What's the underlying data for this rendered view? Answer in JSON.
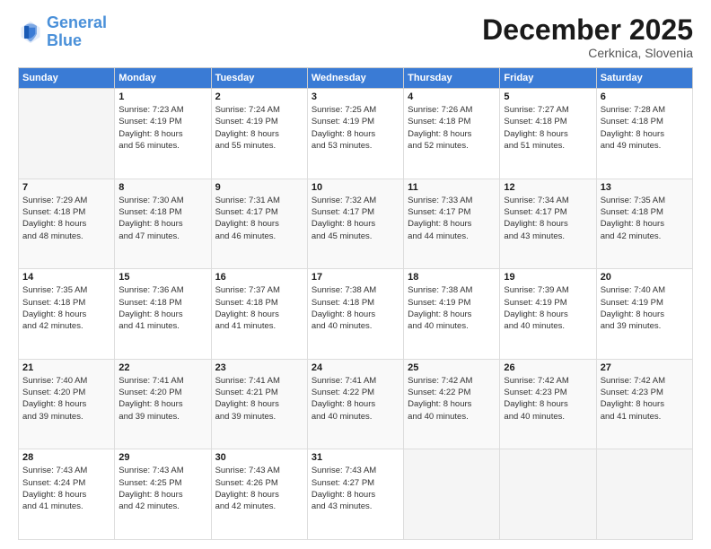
{
  "logo": {
    "line1": "General",
    "line2": "Blue"
  },
  "header": {
    "month": "December 2025",
    "location": "Cerknica, Slovenia"
  },
  "days_of_week": [
    "Sunday",
    "Monday",
    "Tuesday",
    "Wednesday",
    "Thursday",
    "Friday",
    "Saturday"
  ],
  "weeks": [
    [
      {
        "day": "",
        "info": ""
      },
      {
        "day": "1",
        "info": "Sunrise: 7:23 AM\nSunset: 4:19 PM\nDaylight: 8 hours\nand 56 minutes."
      },
      {
        "day": "2",
        "info": "Sunrise: 7:24 AM\nSunset: 4:19 PM\nDaylight: 8 hours\nand 55 minutes."
      },
      {
        "day": "3",
        "info": "Sunrise: 7:25 AM\nSunset: 4:19 PM\nDaylight: 8 hours\nand 53 minutes."
      },
      {
        "day": "4",
        "info": "Sunrise: 7:26 AM\nSunset: 4:18 PM\nDaylight: 8 hours\nand 52 minutes."
      },
      {
        "day": "5",
        "info": "Sunrise: 7:27 AM\nSunset: 4:18 PM\nDaylight: 8 hours\nand 51 minutes."
      },
      {
        "day": "6",
        "info": "Sunrise: 7:28 AM\nSunset: 4:18 PM\nDaylight: 8 hours\nand 49 minutes."
      }
    ],
    [
      {
        "day": "7",
        "info": "Sunrise: 7:29 AM\nSunset: 4:18 PM\nDaylight: 8 hours\nand 48 minutes."
      },
      {
        "day": "8",
        "info": "Sunrise: 7:30 AM\nSunset: 4:18 PM\nDaylight: 8 hours\nand 47 minutes."
      },
      {
        "day": "9",
        "info": "Sunrise: 7:31 AM\nSunset: 4:17 PM\nDaylight: 8 hours\nand 46 minutes."
      },
      {
        "day": "10",
        "info": "Sunrise: 7:32 AM\nSunset: 4:17 PM\nDaylight: 8 hours\nand 45 minutes."
      },
      {
        "day": "11",
        "info": "Sunrise: 7:33 AM\nSunset: 4:17 PM\nDaylight: 8 hours\nand 44 minutes."
      },
      {
        "day": "12",
        "info": "Sunrise: 7:34 AM\nSunset: 4:17 PM\nDaylight: 8 hours\nand 43 minutes."
      },
      {
        "day": "13",
        "info": "Sunrise: 7:35 AM\nSunset: 4:18 PM\nDaylight: 8 hours\nand 42 minutes."
      }
    ],
    [
      {
        "day": "14",
        "info": "Sunrise: 7:35 AM\nSunset: 4:18 PM\nDaylight: 8 hours\nand 42 minutes."
      },
      {
        "day": "15",
        "info": "Sunrise: 7:36 AM\nSunset: 4:18 PM\nDaylight: 8 hours\nand 41 minutes."
      },
      {
        "day": "16",
        "info": "Sunrise: 7:37 AM\nSunset: 4:18 PM\nDaylight: 8 hours\nand 41 minutes."
      },
      {
        "day": "17",
        "info": "Sunrise: 7:38 AM\nSunset: 4:18 PM\nDaylight: 8 hours\nand 40 minutes."
      },
      {
        "day": "18",
        "info": "Sunrise: 7:38 AM\nSunset: 4:19 PM\nDaylight: 8 hours\nand 40 minutes."
      },
      {
        "day": "19",
        "info": "Sunrise: 7:39 AM\nSunset: 4:19 PM\nDaylight: 8 hours\nand 40 minutes."
      },
      {
        "day": "20",
        "info": "Sunrise: 7:40 AM\nSunset: 4:19 PM\nDaylight: 8 hours\nand 39 minutes."
      }
    ],
    [
      {
        "day": "21",
        "info": "Sunrise: 7:40 AM\nSunset: 4:20 PM\nDaylight: 8 hours\nand 39 minutes."
      },
      {
        "day": "22",
        "info": "Sunrise: 7:41 AM\nSunset: 4:20 PM\nDaylight: 8 hours\nand 39 minutes."
      },
      {
        "day": "23",
        "info": "Sunrise: 7:41 AM\nSunset: 4:21 PM\nDaylight: 8 hours\nand 39 minutes."
      },
      {
        "day": "24",
        "info": "Sunrise: 7:41 AM\nSunset: 4:22 PM\nDaylight: 8 hours\nand 40 minutes."
      },
      {
        "day": "25",
        "info": "Sunrise: 7:42 AM\nSunset: 4:22 PM\nDaylight: 8 hours\nand 40 minutes."
      },
      {
        "day": "26",
        "info": "Sunrise: 7:42 AM\nSunset: 4:23 PM\nDaylight: 8 hours\nand 40 minutes."
      },
      {
        "day": "27",
        "info": "Sunrise: 7:42 AM\nSunset: 4:23 PM\nDaylight: 8 hours\nand 41 minutes."
      }
    ],
    [
      {
        "day": "28",
        "info": "Sunrise: 7:43 AM\nSunset: 4:24 PM\nDaylight: 8 hours\nand 41 minutes."
      },
      {
        "day": "29",
        "info": "Sunrise: 7:43 AM\nSunset: 4:25 PM\nDaylight: 8 hours\nand 42 minutes."
      },
      {
        "day": "30",
        "info": "Sunrise: 7:43 AM\nSunset: 4:26 PM\nDaylight: 8 hours\nand 42 minutes."
      },
      {
        "day": "31",
        "info": "Sunrise: 7:43 AM\nSunset: 4:27 PM\nDaylight: 8 hours\nand 43 minutes."
      },
      {
        "day": "",
        "info": ""
      },
      {
        "day": "",
        "info": ""
      },
      {
        "day": "",
        "info": ""
      }
    ]
  ]
}
